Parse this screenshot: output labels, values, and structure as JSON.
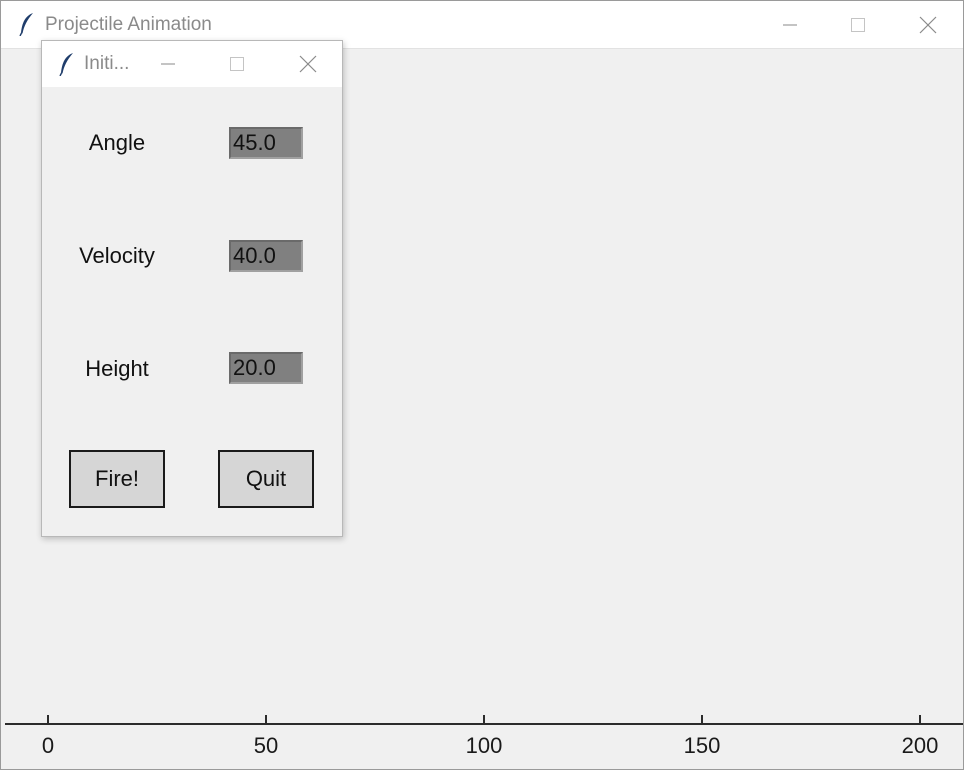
{
  "main_window": {
    "title": "Projectile Animation",
    "icon": "feather-icon",
    "controls": [
      "minimize-icon",
      "maximize-icon",
      "close-icon"
    ]
  },
  "canvas": {
    "axis": {
      "ticks": [
        "0",
        "50",
        "100",
        "150",
        "200"
      ]
    }
  },
  "dialog": {
    "title": "Initi...",
    "icon": "feather-icon",
    "fields": [
      {
        "label": "Angle",
        "value": "45.0"
      },
      {
        "label": "Velocity",
        "value": "40.0"
      },
      {
        "label": "Height",
        "value": "20.0"
      }
    ],
    "buttons": {
      "fire": "Fire!",
      "quit": "Quit"
    }
  },
  "colors": {
    "window_bg": "#f0f0f0",
    "entry_bg": "#808080",
    "button_bg": "#d6d6d6",
    "icon_feather": "#1f3d6b"
  }
}
